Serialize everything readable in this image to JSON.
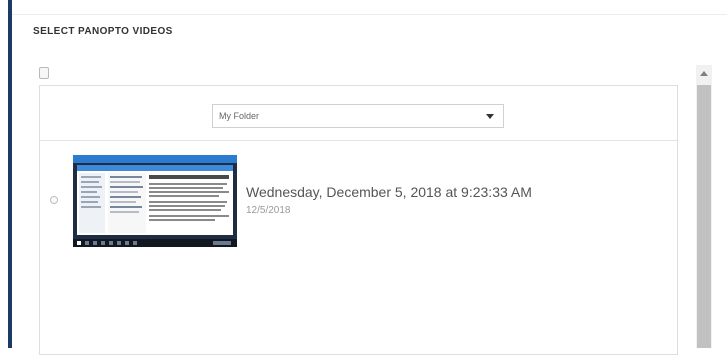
{
  "panel": {
    "title": "SELECT PANOPTO VIDEOS"
  },
  "folder_select": {
    "value": "My Folder"
  },
  "videos": [
    {
      "title": "Wednesday, December 5, 2018 at 9:23:33 AM",
      "date": "12/5/2018",
      "thumbnail_icon": "screen-recording-thumbnail"
    }
  ],
  "colors": {
    "accent_bar": "#1b3a66",
    "scroll_thumb": "#c1c1c1",
    "title_text": "#555555",
    "date_text": "#9a9a9a"
  }
}
